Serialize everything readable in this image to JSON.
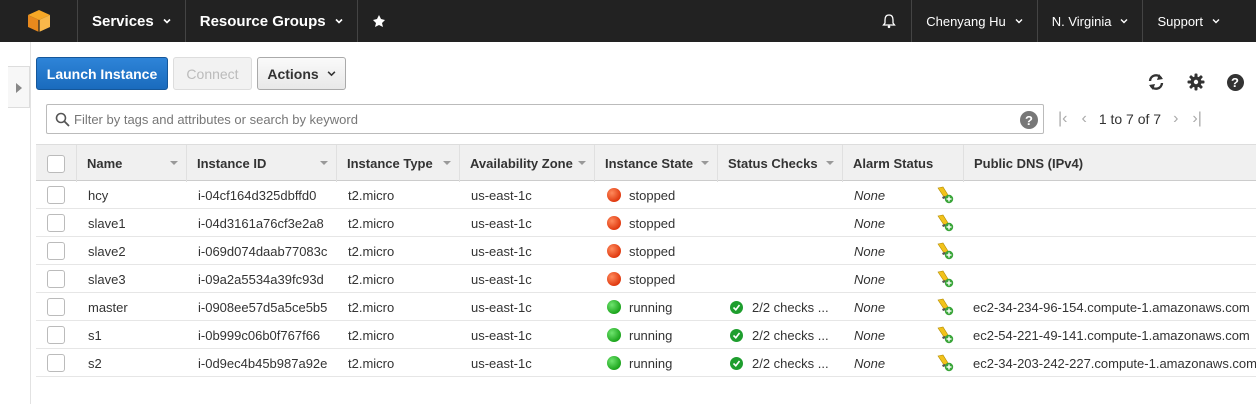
{
  "nav": {
    "services": "Services",
    "resource_groups": "Resource Groups",
    "user": "Chenyang Hu",
    "region": "N. Virginia",
    "support": "Support"
  },
  "toolbar": {
    "launch_label": "Launch Instance",
    "connect_label": "Connect",
    "actions_label": "Actions"
  },
  "search": {
    "placeholder": "Filter by tags and attributes or search by keyword"
  },
  "pager": {
    "text": "1 to 7 of 7"
  },
  "columns": {
    "name": "Name",
    "instance_id": "Instance ID",
    "instance_type": "Instance Type",
    "az": "Availability Zone",
    "state": "Instance State",
    "status": "Status Checks",
    "alarm": "Alarm Status",
    "dns": "Public DNS (IPv4)"
  },
  "rows": [
    {
      "name": "hcy",
      "id": "i-04cf164d325dbffd0",
      "type": "t2.micro",
      "az": "us-east-1c",
      "state": "stopped",
      "status": "",
      "alarm": "None",
      "dns": ""
    },
    {
      "name": "slave1",
      "id": "i-04d3161a76cf3e2a8",
      "type": "t2.micro",
      "az": "us-east-1c",
      "state": "stopped",
      "status": "",
      "alarm": "None",
      "dns": ""
    },
    {
      "name": "slave2",
      "id": "i-069d074daab77083c",
      "type": "t2.micro",
      "az": "us-east-1c",
      "state": "stopped",
      "status": "",
      "alarm": "None",
      "dns": ""
    },
    {
      "name": "slave3",
      "id": "i-09a2a5534a39fc93d",
      "type": "t2.micro",
      "az": "us-east-1c",
      "state": "stopped",
      "status": "",
      "alarm": "None",
      "dns": ""
    },
    {
      "name": "master",
      "id": "i-0908ee57d5a5ce5b5",
      "type": "t2.micro",
      "az": "us-east-1c",
      "state": "running",
      "status": "2/2 checks ...",
      "alarm": "None",
      "dns": "ec2-34-234-96-154.compute-1.amazonaws.com"
    },
    {
      "name": "s1",
      "id": "i-0b999c06b0f767f66",
      "type": "t2.micro",
      "az": "us-east-1c",
      "state": "running",
      "status": "2/2 checks ...",
      "alarm": "None",
      "dns": "ec2-54-221-49-141.compute-1.amazonaws.com"
    },
    {
      "name": "s2",
      "id": "i-0d9ec4b45b987a92e",
      "type": "t2.micro",
      "az": "us-east-1c",
      "state": "running",
      "status": "2/2 checks ...",
      "alarm": "None",
      "dns": "ec2-34-203-242-227.compute-1.amazonaws.com"
    }
  ],
  "colors": {
    "nav_bg": "#222222",
    "primary_button": "#1a6bbd",
    "stopped": "#e03a10",
    "running": "#1da51d"
  },
  "icons": [
    "aws-cube-icon",
    "pin-icon",
    "bell-icon",
    "refresh-icon",
    "gear-icon",
    "help-icon",
    "search-icon",
    "add-alarm-icon"
  ]
}
